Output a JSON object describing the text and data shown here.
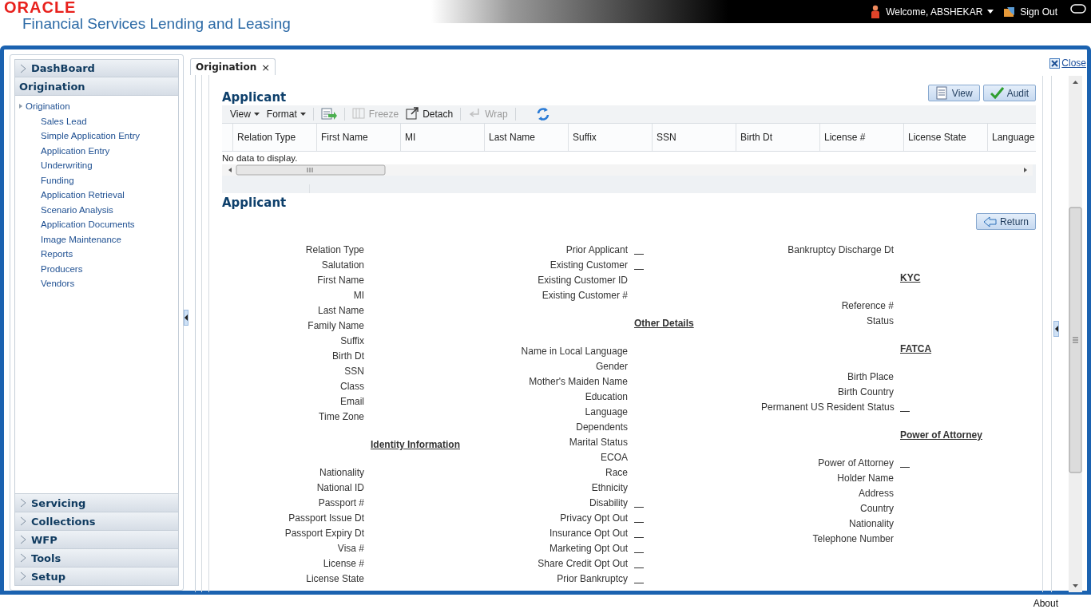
{
  "header": {
    "logo": "ORACLE",
    "product": "Financial Services Lending and Leasing",
    "welcome": "Welcome, ABSHEKAR",
    "sign_out": "Sign Out"
  },
  "sidebar": {
    "sections": [
      {
        "label": "DashBoard",
        "expanded": false
      },
      {
        "label": "Origination",
        "expanded": true,
        "children": [
          {
            "label": "Origination",
            "children": [
              {
                "label": "Sales Lead"
              },
              {
                "label": "Simple Application Entry"
              },
              {
                "label": "Application Entry"
              },
              {
                "label": "Underwriting"
              },
              {
                "label": "Funding"
              },
              {
                "label": "Application Retrieval"
              },
              {
                "label": "Scenario Analysis"
              },
              {
                "label": "Application Documents"
              },
              {
                "label": "Image Maintenance"
              },
              {
                "label": "Reports"
              },
              {
                "label": "Producers"
              },
              {
                "label": "Vendors"
              }
            ]
          }
        ]
      },
      {
        "label": "Servicing",
        "expanded": false
      },
      {
        "label": "Collections",
        "expanded": false
      },
      {
        "label": "WFP",
        "expanded": false
      },
      {
        "label": "Tools",
        "expanded": false
      },
      {
        "label": "Setup",
        "expanded": false
      }
    ]
  },
  "close_link": "Close",
  "tabs": [
    {
      "label": "Origination",
      "selected": true,
      "close": "×"
    }
  ],
  "applicant_grid": {
    "title": "Applicant",
    "buttons": [
      {
        "label": "View",
        "kind": "view"
      },
      {
        "label": "Audit",
        "kind": "audit"
      }
    ],
    "toolbar": [
      [
        {
          "label": "View",
          "kind": "menu",
          "disabled": false
        },
        {
          "label": "Format",
          "kind": "menu",
          "disabled": false
        }
      ],
      [
        {
          "kind": "export",
          "disabled": false
        }
      ],
      [
        {
          "label": "Freeze",
          "kind": "freeze",
          "disabled": true
        },
        {
          "label": "Detach",
          "kind": "detach",
          "disabled": false
        }
      ],
      [
        {
          "label": "Wrap",
          "kind": "wrap",
          "disabled": true
        }
      ],
      [
        {
          "kind": "refresh",
          "disabled": false
        }
      ]
    ],
    "columns": [
      "Relation Type",
      "First Name",
      "MI",
      "Last Name",
      "Suffix",
      "SSN",
      "Birth Dt",
      "License #",
      "License State",
      "Language"
    ],
    "empty_message": "No data to display."
  },
  "detail": {
    "title": "Applicant",
    "return_button": "Return",
    "columns": [
      [
        {
          "label": "Relation Type",
          "kind": "field"
        },
        {
          "label": "Salutation",
          "kind": "field"
        },
        {
          "label": "First Name",
          "kind": "field"
        },
        {
          "label": "MI",
          "kind": "field"
        },
        {
          "label": "Last Name",
          "kind": "field"
        },
        {
          "label": "Family Name",
          "kind": "field"
        },
        {
          "label": "Suffix",
          "kind": "field"
        },
        {
          "label": "Birth Dt",
          "kind": "field"
        },
        {
          "label": "SSN",
          "kind": "field"
        },
        {
          "label": "Class",
          "kind": "field"
        },
        {
          "label": "Email",
          "kind": "field"
        },
        {
          "label": "Time Zone",
          "kind": "field"
        },
        {
          "label": "Identity Information",
          "kind": "heading"
        },
        {
          "label": "Nationality",
          "kind": "field"
        },
        {
          "label": "National ID",
          "kind": "field"
        },
        {
          "label": "Passport #",
          "kind": "field"
        },
        {
          "label": "Passport Issue Dt",
          "kind": "field"
        },
        {
          "label": "Passport Expiry Dt",
          "kind": "field"
        },
        {
          "label": "Visa #",
          "kind": "field"
        },
        {
          "label": "License #",
          "kind": "field"
        },
        {
          "label": "License State",
          "kind": "field"
        }
      ],
      [
        {
          "label": "Prior Applicant",
          "kind": "flag"
        },
        {
          "label": "Existing Customer",
          "kind": "flag"
        },
        {
          "label": "Existing Customer ID",
          "kind": "field"
        },
        {
          "label": "Existing Customer #",
          "kind": "field"
        },
        {
          "label": "Other Details",
          "kind": "heading"
        },
        {
          "label": "Name in Local Language",
          "kind": "field"
        },
        {
          "label": "Gender",
          "kind": "field"
        },
        {
          "label": "Mother's Maiden Name",
          "kind": "field"
        },
        {
          "label": "Education",
          "kind": "field"
        },
        {
          "label": "Language",
          "kind": "field"
        },
        {
          "label": "Dependents",
          "kind": "field"
        },
        {
          "label": "Marital Status",
          "kind": "field"
        },
        {
          "label": "ECOA",
          "kind": "field"
        },
        {
          "label": "Race",
          "kind": "field"
        },
        {
          "label": "Ethnicity",
          "kind": "field"
        },
        {
          "label": "Disability",
          "kind": "flag"
        },
        {
          "label": "Privacy Opt Out",
          "kind": "flag"
        },
        {
          "label": "Insurance Opt Out",
          "kind": "flag"
        },
        {
          "label": "Marketing Opt Out",
          "kind": "flag"
        },
        {
          "label": "Share Credit Opt Out",
          "kind": "flag"
        },
        {
          "label": "Prior Bankruptcy",
          "kind": "flag"
        }
      ],
      [
        {
          "label": "Bankruptcy Discharge Dt",
          "kind": "field"
        },
        {
          "label": "KYC",
          "kind": "heading"
        },
        {
          "label": "Reference #",
          "kind": "field"
        },
        {
          "label": "Status",
          "kind": "field"
        },
        {
          "label": "FATCA",
          "kind": "heading"
        },
        {
          "label": "Birth Place",
          "kind": "field"
        },
        {
          "label": "Birth Country",
          "kind": "field"
        },
        {
          "label": "Permanent US Resident Status",
          "kind": "flag"
        },
        {
          "label": "Power of Attorney",
          "kind": "heading"
        },
        {
          "label": "Power of Attorney",
          "kind": "flag"
        },
        {
          "label": "Holder Name",
          "kind": "field"
        },
        {
          "label": "Address",
          "kind": "field"
        },
        {
          "label": "Country",
          "kind": "field"
        },
        {
          "label": "Nationality",
          "kind": "field"
        },
        {
          "label": "Telephone Number",
          "kind": "field"
        }
      ]
    ]
  },
  "footer": {
    "about": "About"
  }
}
